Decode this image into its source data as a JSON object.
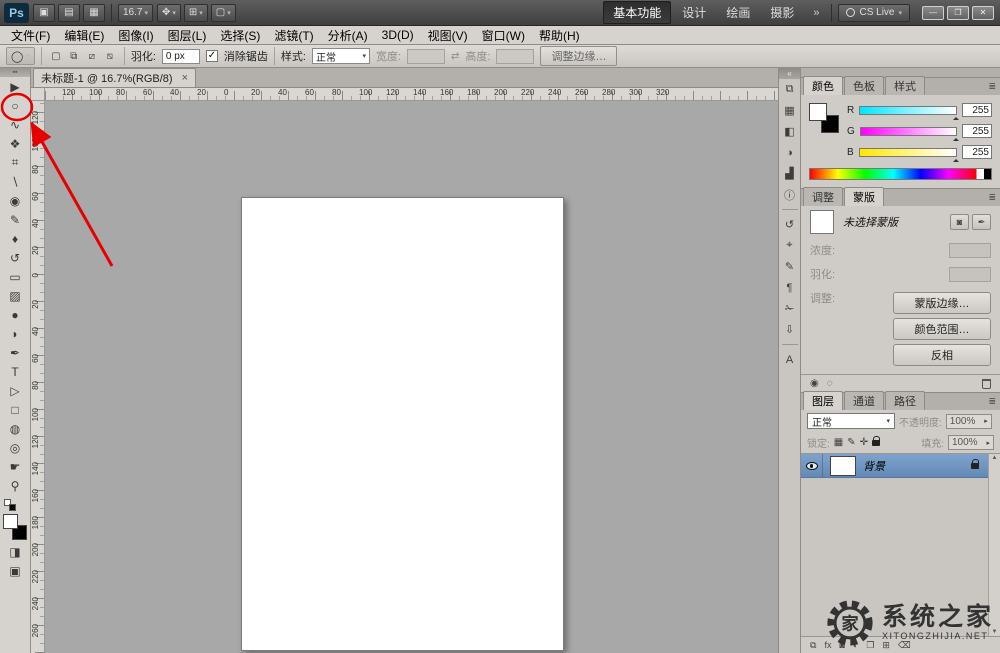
{
  "titlebar": {
    "logo": "Ps",
    "left_icons": [
      {
        "name": "bridge-icon",
        "glyph": "▣"
      },
      {
        "name": "mini-bridge-icon",
        "glyph": "▤"
      },
      {
        "name": "view-extras-icon",
        "glyph": "▦"
      }
    ],
    "zoom_value": "16.7",
    "mid_icons": [
      {
        "name": "hand-rotate-icon",
        "glyph": "✥"
      },
      {
        "name": "arrange-documents-icon",
        "glyph": "⊞"
      },
      {
        "name": "screen-mode-icon",
        "glyph": "▢"
      }
    ],
    "workspaces": [
      {
        "label": "基本功能",
        "active": true
      },
      {
        "label": "设计",
        "active": false
      },
      {
        "label": "绘画",
        "active": false
      },
      {
        "label": "摄影",
        "active": false
      }
    ],
    "workspace_overflow": "»",
    "cs_live": "CS Live",
    "window_buttons": [
      {
        "name": "minimize-button",
        "glyph": "—"
      },
      {
        "name": "restore-button",
        "glyph": "❐"
      },
      {
        "name": "close-button",
        "glyph": "✕"
      }
    ]
  },
  "menubar": {
    "items": [
      "文件(F)",
      "编辑(E)",
      "图像(I)",
      "图层(L)",
      "选择(S)",
      "滤镜(T)",
      "分析(A)",
      "3D(D)",
      "视图(V)",
      "窗口(W)",
      "帮助(H)"
    ]
  },
  "optionsbar": {
    "tool_glyph": "◯",
    "mode_icons": [
      {
        "name": "new-selection-icon",
        "glyph": "▢"
      },
      {
        "name": "add-selection-icon",
        "glyph": "⧉"
      },
      {
        "name": "subtract-selection-icon",
        "glyph": "⧄"
      },
      {
        "name": "intersect-selection-icon",
        "glyph": "⧅"
      }
    ],
    "feather_label": "羽化:",
    "feather_value": "0 px",
    "check_glyph": "✓",
    "antialias_label": "消除锯齿",
    "style_label": "样式:",
    "style_value": "正常",
    "width_label": "宽度:",
    "swap_glyph": "⇄",
    "height_label": "高度:",
    "refine_edge_label": "调整边缘…"
  },
  "toolbar": {
    "collapse_glyph": "▪▪",
    "tools": [
      {
        "name": "move-tool",
        "glyph": "▶"
      },
      {
        "name": "elliptical-marquee-tool",
        "glyph": "○"
      },
      {
        "name": "lasso-tool",
        "glyph": "∿"
      },
      {
        "name": "quick-selection-tool",
        "glyph": "❖"
      },
      {
        "name": "crop-tool",
        "glyph": "⌗"
      },
      {
        "name": "eyedropper-tool",
        "glyph": "∖"
      },
      {
        "name": "spot-healing-brush-tool",
        "glyph": "◉"
      },
      {
        "name": "brush-tool",
        "glyph": "✎"
      },
      {
        "name": "clone-stamp-tool",
        "glyph": "♦"
      },
      {
        "name": "history-brush-tool",
        "glyph": "↺"
      },
      {
        "name": "eraser-tool",
        "glyph": "▭"
      },
      {
        "name": "gradient-tool",
        "glyph": "▨"
      },
      {
        "name": "blur-tool",
        "glyph": "●"
      },
      {
        "name": "dodge-tool",
        "glyph": "◗"
      },
      {
        "name": "pen-tool",
        "glyph": "✒"
      },
      {
        "name": "type-tool",
        "glyph": "T"
      },
      {
        "name": "path-selection-tool",
        "glyph": "▷"
      },
      {
        "name": "shape-tool",
        "glyph": "□"
      },
      {
        "name": "rotate-3d-tool",
        "glyph": "◍"
      },
      {
        "name": "orbit-3d-tool",
        "glyph": "◎"
      },
      {
        "name": "hand-tool",
        "glyph": "☛"
      },
      {
        "name": "zoom-tool",
        "glyph": "⚲"
      }
    ],
    "bottom_icons": [
      {
        "name": "quick-mask-icon",
        "glyph": "◨"
      },
      {
        "name": "screen-mode-toggle-icon",
        "glyph": "▣"
      }
    ]
  },
  "document": {
    "tab_title": "未标题-1 @ 16.7%(RGB/8)",
    "close_glyph": "×",
    "ruler_h": [
      "120",
      "100",
      "80",
      "60",
      "40",
      "20",
      "0",
      "20",
      "40",
      "60",
      "80",
      "100",
      "120",
      "140",
      "160",
      "180",
      "200",
      "220",
      "240",
      "260",
      "280",
      "300",
      "320"
    ],
    "ruler_v": [
      "120",
      "100",
      "80",
      "60",
      "40",
      "20",
      "0",
      "20",
      "40",
      "60",
      "80",
      "100",
      "120",
      "140",
      "160",
      "180",
      "200",
      "220",
      "240",
      "260"
    ]
  },
  "dock": {
    "collapse_glyph": "«",
    "groups": [
      [
        {
          "name": "clone-source-icon",
          "glyph": "⧉"
        },
        {
          "name": "swatches-icon",
          "glyph": "▦"
        },
        {
          "name": "styles-icon",
          "glyph": "◧"
        },
        {
          "name": "adjustments-icon",
          "glyph": "◑"
        },
        {
          "name": "histogram-icon",
          "glyph": "▟"
        },
        {
          "name": "info-icon",
          "glyph": "ⓘ"
        }
      ],
      [
        {
          "name": "history-icon",
          "glyph": "↺"
        },
        {
          "name": "navigator-icon",
          "glyph": "⌖"
        },
        {
          "name": "character-icon",
          "glyph": "✎"
        },
        {
          "name": "paragraph-icon",
          "glyph": "¶"
        },
        {
          "name": "notes-icon",
          "glyph": "✁"
        },
        {
          "name": "measure-icon",
          "glyph": "⇩"
        }
      ],
      [
        {
          "name": "actions-icon",
          "glyph": "A"
        }
      ]
    ]
  },
  "panels": {
    "color": {
      "tabs": [
        "颜色",
        "色板",
        "样式"
      ],
      "channels": [
        {
          "label": "R",
          "value": "255",
          "gradient_from": "#00e5ff"
        },
        {
          "label": "G",
          "value": "255",
          "gradient_from": "#ff00ff"
        },
        {
          "label": "B",
          "value": "255",
          "gradient_from": "#ffe700"
        }
      ],
      "spectrum_colors": [
        "#ff0000",
        "#ffff00",
        "#00ff00",
        "#00ffff",
        "#0000ff",
        "#ff00ff",
        "#ff0000"
      ]
    },
    "masks": {
      "tabs": [
        "调整",
        "蒙版"
      ],
      "no_mask": "未选择蒙版",
      "pixel_mask_glyph": "◙",
      "vector_mask_glyph": "✒",
      "density_label": "浓度:",
      "feather_label": "羽化:",
      "refine_label": "调整:",
      "mask_edge": "蒙版边缘…",
      "color_range": "颜色范围…",
      "invert": "反相",
      "foot_icons": [
        {
          "name": "load-mask-selection-icon",
          "glyph": "◉"
        },
        {
          "name": "disable-mask-icon",
          "glyph": "◌"
        }
      ]
    },
    "layers": {
      "tabs": [
        "图层",
        "通道",
        "路径"
      ],
      "blend_mode": "正常",
      "opacity_label": "不透明度:",
      "opacity_value": "100%",
      "lock_label": "锁定:",
      "lock_icons": [
        "▦",
        "✎",
        "✛"
      ],
      "fill_label": "填充:",
      "fill_value": "100%",
      "items": [
        {
          "name": "背景",
          "visible": true,
          "locked": true,
          "selected": true
        }
      ],
      "footer_icons": [
        {
          "name": "link-layers-icon",
          "glyph": "⧉"
        },
        {
          "name": "layer-style-icon",
          "glyph": "fx"
        },
        {
          "name": "add-mask-icon",
          "glyph": "◙"
        },
        {
          "name": "adjustment-layer-icon",
          "glyph": "◐"
        },
        {
          "name": "new-group-icon",
          "glyph": "❐"
        },
        {
          "name": "new-layer-icon",
          "glyph": "⊞"
        },
        {
          "name": "delete-layer-icon",
          "glyph": "⌫"
        }
      ],
      "scroll_up_glyph": "▲",
      "scroll_down_glyph": "▼"
    }
  },
  "annotation": {
    "color": "#e60000"
  },
  "watermark": {
    "gear_char": "家",
    "line1": "系统之家",
    "line2": "XITONGZHIJIA.NET"
  }
}
